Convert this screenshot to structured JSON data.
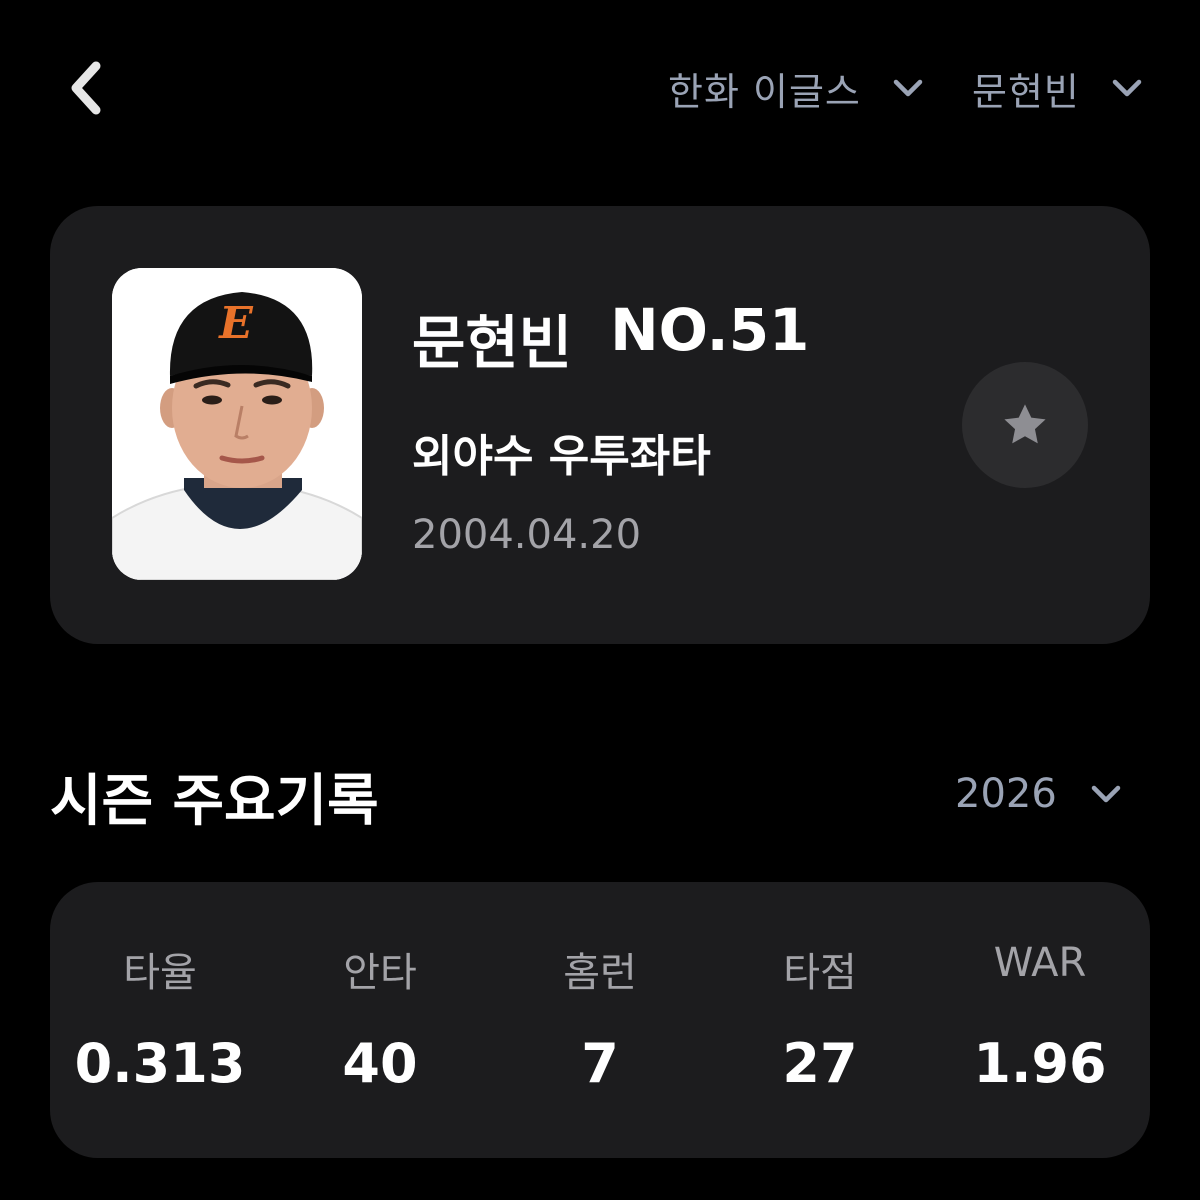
{
  "header": {
    "team_selector_label": "한화 이글스",
    "player_selector_label": "문현빈"
  },
  "profile": {
    "name": "문현빈",
    "number": "NO.51",
    "position": "외야수 우투좌타",
    "birth_date": "2004.04.20",
    "photo_icon": "player-photo",
    "favorite_icon": "star-icon"
  },
  "season": {
    "title": "시즌 주요기록",
    "year": "2026",
    "stats": [
      {
        "label": "타율",
        "value": "0.313"
      },
      {
        "label": "안타",
        "value": "40"
      },
      {
        "label": "홈런",
        "value": "7"
      },
      {
        "label": "타점",
        "value": "27"
      },
      {
        "label": "WAR",
        "value": "1.96"
      }
    ]
  },
  "colors": {
    "background": "#000000",
    "card": "#1c1c1e",
    "muted_text": "#a3a3a8",
    "selector_text": "#9aa3b5",
    "cap": "#111111",
    "cap_logo": "#e8722a"
  }
}
